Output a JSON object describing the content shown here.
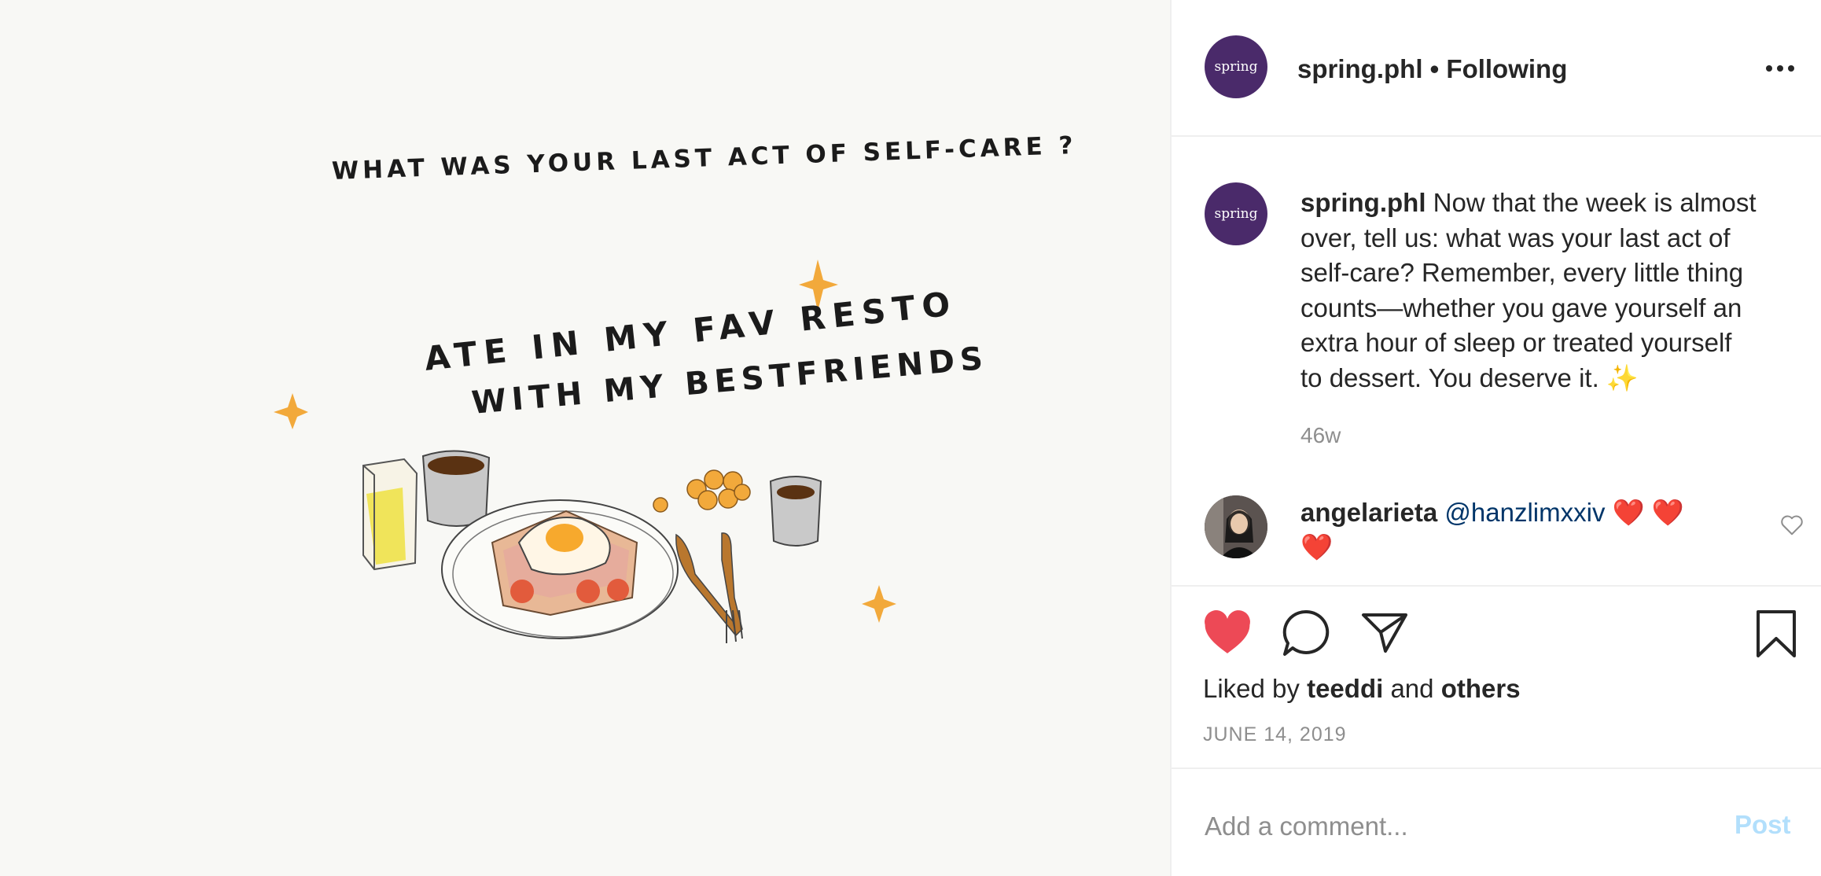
{
  "media": {
    "question": "WHAT WAS YOUR LAST ACT OF SELF-CARE ?",
    "answer_line1": "ATE IN MY FAV RESTO",
    "answer_line2": "WITH MY BESTFRIENDS"
  },
  "header": {
    "avatar_text": "spring",
    "username": "spring.phl",
    "separator": "•",
    "follow_status": "Following",
    "more_icon": "more-horizontal-icon"
  },
  "caption": {
    "avatar_text": "spring",
    "username": "spring.phl",
    "lines": [
      "Now that the week is almost",
      "over, tell us: what was your last act of",
      "self-care? Remember, every little thing",
      "counts—whether you gave yourself an",
      "extra hour of sleep or treated yourself",
      "to dessert. You deserve it. ✨"
    ],
    "time": "46w"
  },
  "comment": {
    "username": "angelarieta",
    "mention": "@hanzlimxxiv",
    "hearts_line1": "❤️ ❤️",
    "hearts_line2": "❤️"
  },
  "actions": {
    "like_icon": "heart-filled-icon",
    "comment_icon": "comment-icon",
    "share_icon": "paper-plane-icon",
    "save_icon": "bookmark-icon",
    "like_color": "#ed4956"
  },
  "likes": {
    "prefix": "Liked by",
    "user": "teeddi",
    "conj": "and",
    "others": "others"
  },
  "date": "JUNE 14, 2019",
  "comment_box": {
    "placeholder": "Add a comment...",
    "post_label": "Post",
    "post_color": "#b2dffc"
  }
}
